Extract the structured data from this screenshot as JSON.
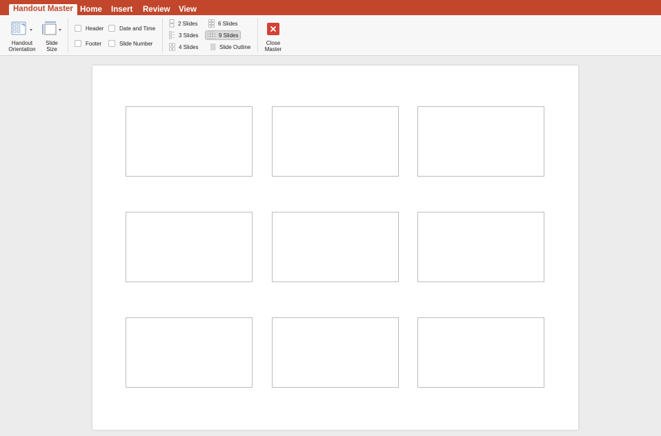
{
  "tabs": [
    {
      "label": "Handout Master",
      "active": true
    },
    {
      "label": "Home",
      "active": false
    },
    {
      "label": "Insert",
      "active": false
    },
    {
      "label": "Review",
      "active": false
    },
    {
      "label": "View",
      "active": false
    }
  ],
  "ribbon": {
    "handout_orientation": {
      "line1": "Handout",
      "line2": "Orientation"
    },
    "slide_size": {
      "line1": "Slide",
      "line2": "Size"
    },
    "placeholders": {
      "header": "Header",
      "date_time": "Date and Time",
      "footer": "Footer",
      "slide_number": "Slide Number"
    },
    "layouts": {
      "two": "2 Slides",
      "three": "3 Slides",
      "four": "4 Slides",
      "six": "6 Slides",
      "nine": "9 Slides",
      "outline": "Slide Outline",
      "selected": "9 Slides"
    },
    "close_master": {
      "line1": "Close",
      "line2": "Master"
    }
  },
  "colors": {
    "tab_bar": "#c1462b",
    "ribbon_bg": "#f7f7f7",
    "close_button": "#d24236",
    "workspace_bg": "#ececec"
  },
  "handout": {
    "slide_placeholder_count": 9
  }
}
